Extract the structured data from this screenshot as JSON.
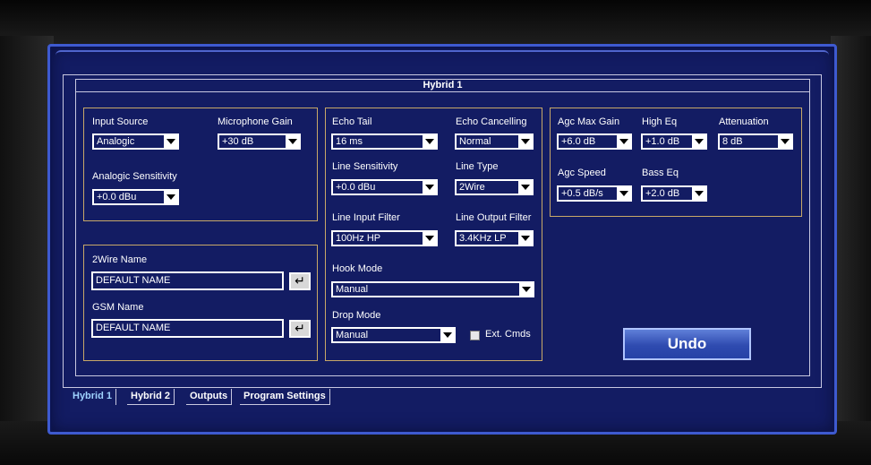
{
  "panel_title": "Hybrid 1",
  "input_group": {
    "input_source": {
      "label": "Input Source",
      "value": "Analogic"
    },
    "microphone_gain": {
      "label": "Microphone Gain",
      "value": "+30 dB"
    },
    "analogic_sensitivity": {
      "label": "Analogic Sensitivity",
      "value": "+0.0 dBu"
    }
  },
  "names_group": {
    "twowire": {
      "label": "2Wire Name",
      "value": "DEFAULT NAME"
    },
    "gsm": {
      "label": "GSM Name",
      "value": "DEFAULT NAME"
    },
    "enter_glyph": "↵"
  },
  "line_group": {
    "echo_tail": {
      "label": "Echo Tail",
      "value": "16 ms"
    },
    "echo_cancelling": {
      "label": "Echo Cancelling",
      "value": "Normal"
    },
    "line_sensitivity": {
      "label": "Line Sensitivity",
      "value": "+0.0 dBu"
    },
    "line_type": {
      "label": "Line Type",
      "value": "2Wire"
    },
    "line_input_filter": {
      "label": "Line Input Filter",
      "value": "100Hz HP"
    },
    "line_output_filter": {
      "label": "Line Output Filter",
      "value": "3.4KHz LP"
    },
    "hook_mode": {
      "label": "Hook Mode",
      "value": "Manual"
    },
    "drop_mode": {
      "label": "Drop Mode",
      "value": "Manual"
    },
    "ext_cmds": {
      "label": "Ext. Cmds",
      "checked": false
    }
  },
  "agc_group": {
    "agc_max_gain": {
      "label": "Agc Max Gain",
      "value": "+6.0 dB"
    },
    "high_eq": {
      "label": "High Eq",
      "value": "+1.0 dB"
    },
    "attenuation": {
      "label": "Attenuation",
      "value": "8 dB"
    },
    "agc_speed": {
      "label": "Agc Speed",
      "value": "+0.5 dB/s"
    },
    "bass_eq": {
      "label": "Bass Eq",
      "value": "+2.0 dB"
    }
  },
  "undo_label": "Undo",
  "tabs": [
    "Hybrid 1",
    "Hybrid 2",
    "Outputs",
    "Program Settings"
  ],
  "colors": {
    "panel_bg": "#131c63",
    "frame_blue": "#3e5ad0",
    "group_border": "#c8a868",
    "active_tab": "#9fd3ff"
  }
}
